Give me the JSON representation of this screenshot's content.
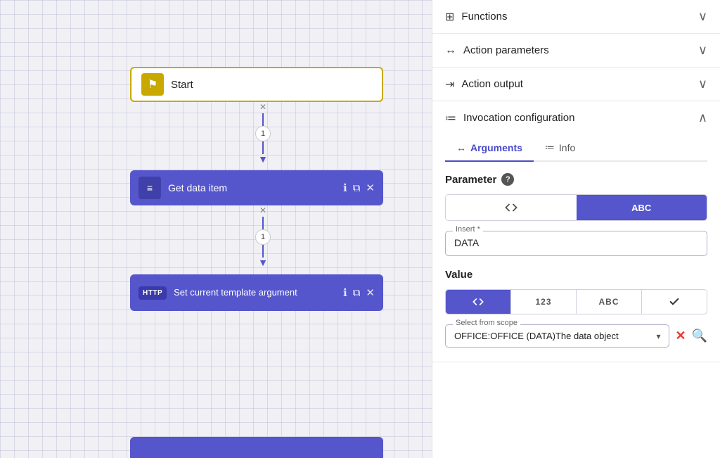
{
  "panel": {
    "sections": [
      {
        "id": "functions",
        "label": "Functions",
        "icon": "⊞",
        "expanded": false,
        "chevron": "∨"
      },
      {
        "id": "action-parameters",
        "label": "Action parameters",
        "icon": "↔",
        "expanded": false,
        "chevron": "∨"
      },
      {
        "id": "action-output",
        "label": "Action output",
        "icon": "⇥",
        "expanded": false,
        "chevron": "∨"
      },
      {
        "id": "invocation-config",
        "label": "Invocation configuration",
        "icon": "≔",
        "expanded": true,
        "chevron": "∧"
      }
    ],
    "invocation": {
      "tabs": [
        {
          "id": "arguments",
          "label": "Arguments",
          "icon": "↔",
          "active": true
        },
        {
          "id": "info",
          "label": "Info",
          "icon": "≔",
          "active": false
        }
      ],
      "parameter": {
        "label": "Parameter",
        "help": "?",
        "toggle_code": "◇",
        "toggle_abc": "ABC",
        "active_toggle": "abc",
        "insert_label": "Insert *",
        "insert_value": "DATA"
      },
      "value": {
        "label": "Value",
        "types": [
          {
            "id": "code",
            "label": "◇",
            "active": true
          },
          {
            "id": "num",
            "label": "123",
            "active": false
          },
          {
            "id": "abc",
            "label": "ABC",
            "active": false
          },
          {
            "id": "check",
            "label": "✓",
            "active": false
          }
        ],
        "scope_label": "Select from scope",
        "scope_value": "OFFICE:OFFICE (DATA)The data object"
      }
    }
  },
  "canvas": {
    "nodes": [
      {
        "id": "start",
        "type": "start",
        "label": "Start"
      },
      {
        "id": "get-data",
        "type": "action",
        "label": "Get data item"
      },
      {
        "id": "set-template",
        "type": "http",
        "badge": "HTTP",
        "label": "Set current template argument"
      }
    ],
    "connectors": [
      {
        "from": "start",
        "to": "get-data",
        "badge": "1"
      },
      {
        "from": "get-data",
        "to": "set-template",
        "badge": "1"
      }
    ]
  }
}
